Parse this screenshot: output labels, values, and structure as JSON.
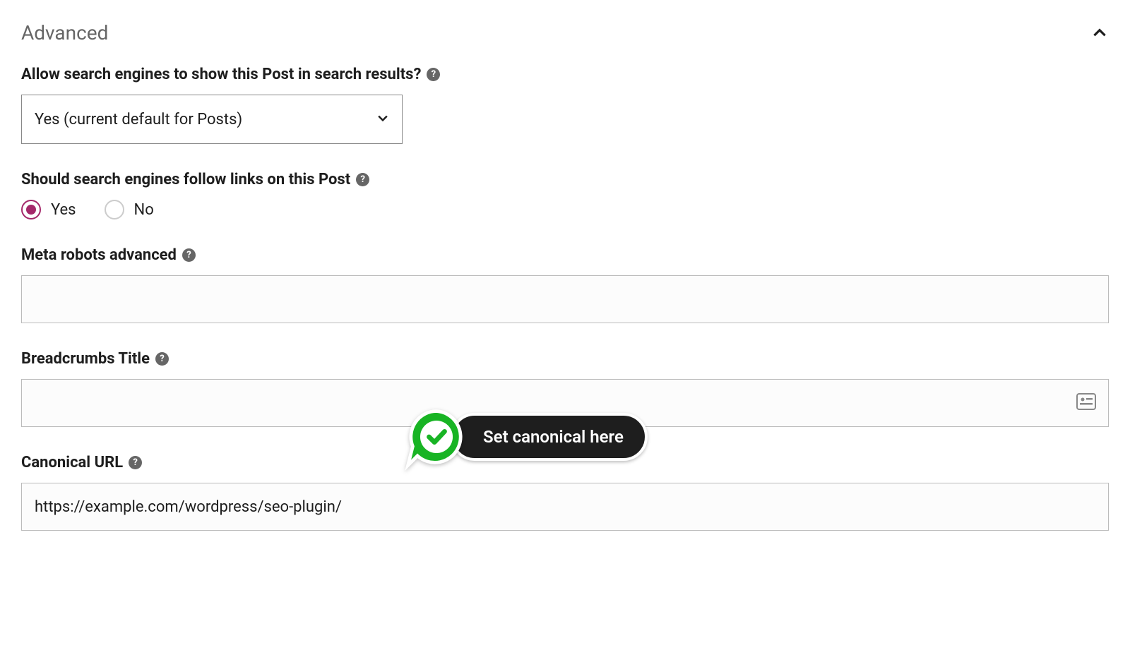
{
  "panel": {
    "title": "Advanced"
  },
  "fields": {
    "allow_search": {
      "label": "Allow search engines to show this Post in search results?",
      "selected": "Yes (current default for Posts)"
    },
    "follow_links": {
      "label": "Should search engines follow links on this Post",
      "options": {
        "yes": "Yes",
        "no": "No"
      },
      "selected": "yes"
    },
    "meta_robots": {
      "label": "Meta robots advanced",
      "value": ""
    },
    "breadcrumbs": {
      "label": "Breadcrumbs Title",
      "value": ""
    },
    "canonical": {
      "label": "Canonical URL",
      "value": "https://example.com/wordpress/seo-plugin/",
      "callout": "Set canonical here"
    }
  }
}
